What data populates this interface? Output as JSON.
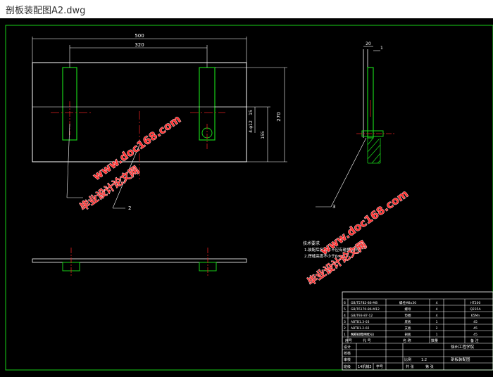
{
  "window": {
    "title": "剖板装配图A2.dwg"
  },
  "drawing": {
    "dims": {
      "overall_width": "500",
      "inner_width": "320",
      "height_right": "270",
      "d1": "15",
      "d2": "4-φ12",
      "d3": "155",
      "side_d1": "20",
      "side_d2": "1"
    },
    "callouts": {
      "c1": "2",
      "c2": "3"
    },
    "tech_notes": {
      "heading": "技术要求",
      "line1": "1.装配后各零件不应有碰撞影响。",
      "line2": "2.焊缝高度不小于6mm"
    },
    "watermark": {
      "line1": "毕业设计论文网",
      "line2": "www.doc168.com"
    }
  },
  "title_block": {
    "rows": [
      {
        "no": "6",
        "code": "GB/T5782-86-M8",
        "name": "螺栓M8x30",
        "qty": "4",
        "material": "HT200"
      },
      {
        "no": "5",
        "code": "GB/T6170-86-M12",
        "name": "螺母",
        "qty": "4",
        "material": "Q235A"
      },
      {
        "no": "4",
        "code": "GB/T93-87-12",
        "name": "垫圈",
        "qty": "4",
        "material": "65Mn"
      },
      {
        "no": "3",
        "code": "ABTB1.3-03",
        "name": "底板",
        "qty": "1",
        "material": "45"
      },
      {
        "no": "2",
        "code": "ABTB1.2-02",
        "name": "支板",
        "qty": "2",
        "material": "45"
      },
      {
        "no": "1",
        "code": "ABTB1.1-01",
        "name": "剖板",
        "qty": "1",
        "material": "45"
      }
    ],
    "header": {
      "seq": "序号",
      "code": "代 号",
      "name": "名 称",
      "qty": "数量",
      "remark": "备 注"
    },
    "code_note": "代号(1零件代号)",
    "labels": {
      "design": "设计",
      "check": "校核",
      "approve": "审核",
      "craft": "工艺",
      "class": "班级",
      "student_id": "学号",
      "ratio": "比例",
      "ratio_val": "1:2",
      "sheet": "共 张",
      "sheet2": "第 张"
    },
    "school": "徐州工程学院",
    "drawing_name": "剖板装配图",
    "class_value": "14机械3"
  }
}
